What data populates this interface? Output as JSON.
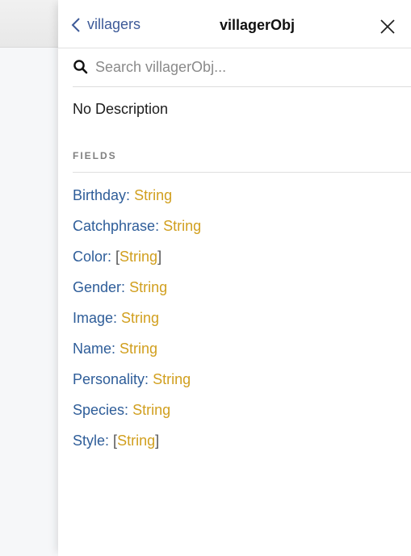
{
  "panel": {
    "back_label": "villagers",
    "title": "villagerObj",
    "close_icon": "close-icon",
    "back_icon": "chevron-left-icon"
  },
  "search": {
    "icon": "search-icon",
    "placeholder": "Search villagerObj...",
    "value": ""
  },
  "description": "No Description",
  "fields_section": {
    "title": "FIELDS",
    "items": [
      {
        "name": "Birthday",
        "type": "String",
        "is_list": false
      },
      {
        "name": "Catchphrase",
        "type": "String",
        "is_list": false
      },
      {
        "name": "Color",
        "type": "String",
        "is_list": true
      },
      {
        "name": "Gender",
        "type": "String",
        "is_list": false
      },
      {
        "name": "Image",
        "type": "String",
        "is_list": false
      },
      {
        "name": "Name",
        "type": "String",
        "is_list": false
      },
      {
        "name": "Personality",
        "type": "String",
        "is_list": false
      },
      {
        "name": "Species",
        "type": "String",
        "is_list": false
      },
      {
        "name": "Style",
        "type": "String",
        "is_list": true
      }
    ]
  },
  "colors": {
    "field_name": "#2e5d99",
    "field_type": "#d19f1e",
    "back_link": "#3d5a98"
  }
}
